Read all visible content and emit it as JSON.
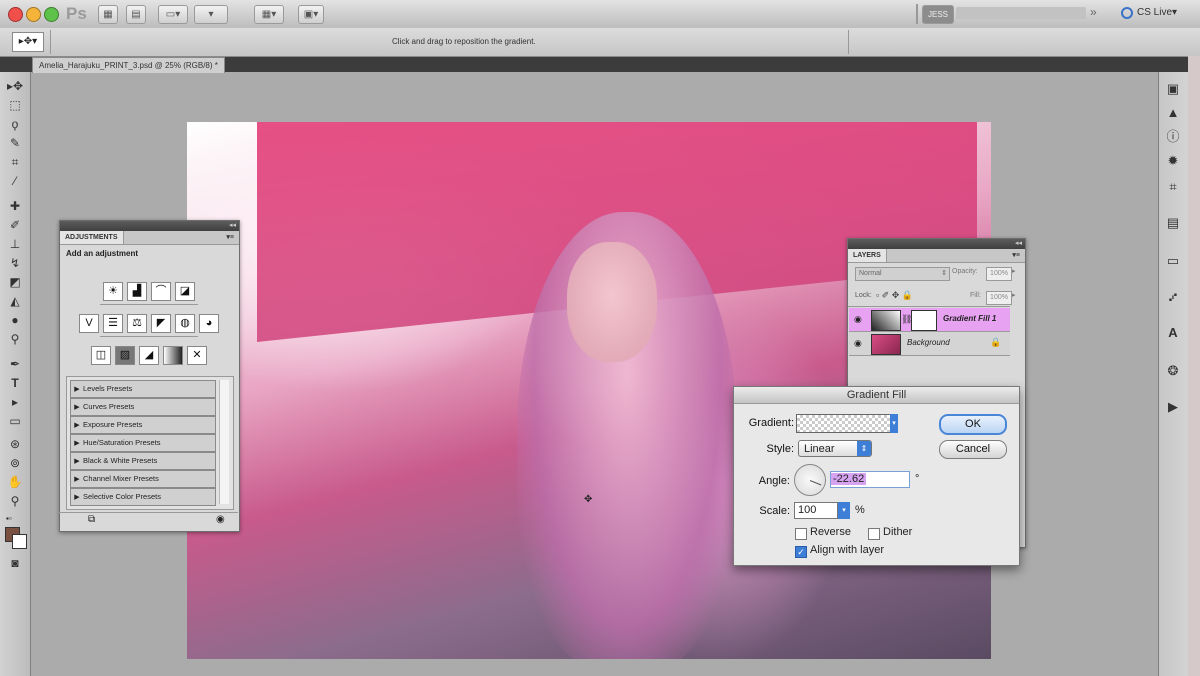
{
  "app": {
    "logo": "Ps",
    "workspace": "JESS",
    "cs_live": "CS Live",
    "hint": "Click and drag to reposition the gradient."
  },
  "document": {
    "tab_title": "Amelia_Harajuku_PRINT_3.psd @ 25% (RGB/8) *"
  },
  "adjustments": {
    "tab": "ADJUSTMENTS",
    "subtitle": "Add an adjustment",
    "presets": [
      "Levels Presets",
      "Curves Presets",
      "Exposure Presets",
      "Hue/Saturation Presets",
      "Black & White Presets",
      "Channel Mixer Presets",
      "Selective Color Presets"
    ]
  },
  "layers": {
    "tab": "LAYERS",
    "blend_mode": "Normal",
    "opacity_label": "Opacity:",
    "opacity_value": "100%",
    "lock_label": "Lock:",
    "fill_label": "Fill:",
    "fill_value": "100%",
    "rows": [
      {
        "name": "Gradient Fill 1"
      },
      {
        "name": "Background"
      }
    ]
  },
  "dialog": {
    "title": "Gradient Fill",
    "gradient_label": "Gradient:",
    "style_label": "Style:",
    "style_value": "Linear",
    "angle_label": "Angle:",
    "angle_value": "-22.62",
    "angle_unit": "°",
    "scale_label": "Scale:",
    "scale_value": "100",
    "scale_unit": "%",
    "reverse_label": "Reverse",
    "dither_label": "Dither",
    "align_label": "Align with layer",
    "ok_label": "OK",
    "cancel_label": "Cancel"
  },
  "colors": {
    "selected_layer": "#e7a2f2",
    "ok_border": "#4a86d8",
    "foreground_swatch": "#7a5040"
  }
}
